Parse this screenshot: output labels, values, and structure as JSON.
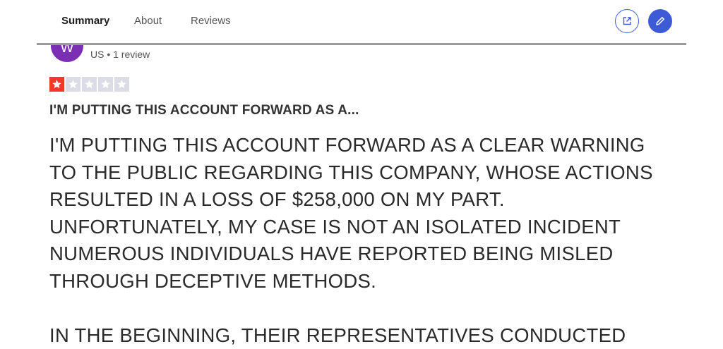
{
  "tabs": [
    {
      "label": "Summary",
      "active": true
    },
    {
      "label": "About",
      "active": false
    },
    {
      "label": "Reviews",
      "active": false
    }
  ],
  "actions": {
    "share_icon": "external-link-icon",
    "edit_icon": "pencil-icon"
  },
  "reviewer": {
    "avatar_initial": "W",
    "meta": "US • 1 review"
  },
  "rating": {
    "value": 1,
    "max": 5,
    "filled_color": "#f0392b",
    "empty_color": "#dcdce6"
  },
  "review": {
    "title": "I'M PUTTING THIS ACCOUNT FORWARD AS A...",
    "lines": [
      "I'M PUTTING THIS ACCOUNT FORWARD AS A CLEAR WARNING",
      "TO THE PUBLIC REGARDING THIS COMPANY, WHOSE ACTIONS",
      "RESULTED IN A LOSS OF $258,000 ON MY PART.",
      "UNFORTUNATELY, MY CASE IS NOT AN ISOLATED INCIDENT",
      "NUMEROUS INDIVIDUALS HAVE REPORTED BEING MISLED",
      "THROUGH DECEPTIVE METHODS."
    ],
    "next_paragraph": "IN THE BEGINNING, THEIR REPRESENTATIVES CONDUCTED"
  },
  "colors": {
    "accent": "#3d5bd4",
    "avatar": "#7a2fb5"
  }
}
